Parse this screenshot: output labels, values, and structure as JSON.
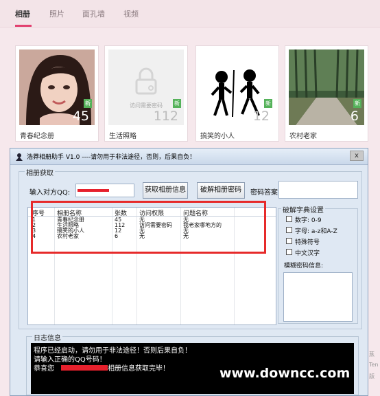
{
  "site": {
    "tabs": [
      {
        "label": "相册"
      },
      {
        "label": "照片"
      },
      {
        "label": "面孔墙"
      },
      {
        "label": "视频"
      }
    ],
    "albums": [
      {
        "name": "青春纪念册",
        "count": "45",
        "badge": "新"
      },
      {
        "name": "生活照略",
        "count": "112",
        "badge": "新",
        "lock_text": "访问需要密码"
      },
      {
        "name": "搞笑的小人",
        "count": "12",
        "badge": "新"
      },
      {
        "name": "农村老家",
        "count": "6",
        "badge": "新"
      }
    ],
    "right_edge": [
      "蒸",
      "Ten",
      "版"
    ]
  },
  "app": {
    "title": "浩莽相册助手 V1.0     ----请勿用于非法途径，否则，后果自负！",
    "close_label": "x",
    "fetch_group": "相册获取",
    "qq_label": "输入对方QQ:",
    "get_info_button": "获取相册信息",
    "crack_button": "破解相册密码",
    "answer_label": "密码答案:",
    "list": {
      "headers": [
        "序号",
        "相册名称",
        "张数",
        "访问权限",
        "问题名称"
      ],
      "rows": [
        [
          "1",
          "青春纪念册",
          "45",
          "无",
          "无"
        ],
        [
          "2",
          "生活照略",
          "112",
          "访问需要密码",
          "我老家哪地方的"
        ],
        [
          "3",
          "搞笑的小人",
          "12",
          "无",
          "无"
        ],
        [
          "4",
          "农村老家",
          "6",
          "无",
          "无"
        ]
      ]
    },
    "dict_group": "破解字典设置",
    "dict_options": [
      {
        "label": "数字: 0-9"
      },
      {
        "label": "字母: a-z和A-Z"
      },
      {
        "label": "特殊符号"
      },
      {
        "label": "中文汉字"
      }
    ],
    "fuzzy_label": "模糊密码信息:",
    "log_group": "日志信息",
    "log_lines": [
      "程序已经启动，请勿用于非法途径！否则后果自负！",
      "请输入正确的QQ号码！",
      "恭喜您",
      "相册信息获取完毕！"
    ],
    "watermark": "www.downcc.com"
  },
  "colors": {
    "accent": "#e2406f",
    "highlight_box": "#e62a2a",
    "badge_green": "#55b25a"
  }
}
